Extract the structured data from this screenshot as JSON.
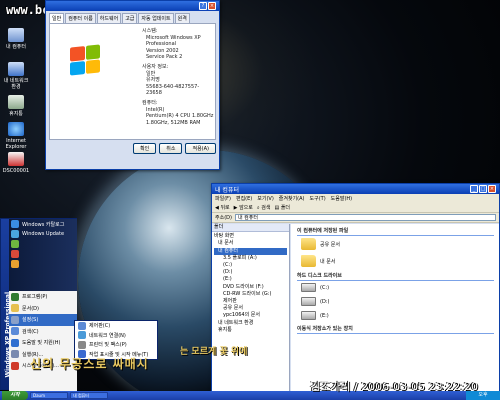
{
  "watermark": "www.bcpark.net",
  "desktop_icons": [
    {
      "label": "내 컴퓨터"
    },
    {
      "label": "내 네트워크 환경"
    },
    {
      "label": "휴지통"
    },
    {
      "label": "Internet Explorer"
    },
    {
      "label": "DSC00001"
    }
  ],
  "sysprops": {
    "tabs": [
      "일반",
      "컴퓨터 이름",
      "하드웨어",
      "고급",
      "자동 업데이트",
      "원격"
    ],
    "system_heading": "시스템:",
    "system_lines": [
      "Microsoft Windows XP",
      "Professional",
      "Version 2002",
      "Service Pack 2"
    ],
    "user_heading": "사용자 정보:",
    "user_lines": [
      "일반",
      "유저명",
      "55683-640-4827557-23658"
    ],
    "computer_heading": "컴퓨터:",
    "computer_lines": [
      "Intel(R)",
      "Pentium(R) 4 CPU 1.80GHz",
      "1.80GHz, 512MB RAM"
    ],
    "buttons": [
      "확인",
      "취소",
      "적용(A)"
    ]
  },
  "explorer": {
    "title": "내 컴퓨터",
    "menu": [
      "파일(F)",
      "편집(E)",
      "보기(V)",
      "즐겨찾기(A)",
      "도구(T)",
      "도움말(H)"
    ],
    "toolbar": [
      "뒤로",
      "앞으로",
      "검색",
      "폴더"
    ],
    "address_label": "주소(D)",
    "address": "내 컴퓨터",
    "tree_header": "폴더",
    "tree": [
      {
        "label": "바탕 화면",
        "selected": false
      },
      {
        "label": "내 문서",
        "selected": false
      },
      {
        "label": "내 컴퓨터",
        "selected": true
      },
      {
        "label": "3.5 플로피 (A:)",
        "selected": false
      },
      {
        "label": "(C:)",
        "selected": false
      },
      {
        "label": "(D:)",
        "selected": false
      },
      {
        "label": "(E:)",
        "selected": false
      },
      {
        "label": "DVD 드라이브 (F:)",
        "selected": false
      },
      {
        "label": "CD-RW 드라이브 (G:)",
        "selected": false
      },
      {
        "label": "제어판",
        "selected": false
      },
      {
        "label": "공유 문서",
        "selected": false
      },
      {
        "label": "ypc1064의 문서",
        "selected": false
      },
      {
        "label": "내 네트워크 환경",
        "selected": false
      },
      {
        "label": "휴지통",
        "selected": false
      }
    ],
    "group1": "이 컴퓨터에 저장된 파일",
    "folders": [
      "공유 문서",
      "내 문서"
    ],
    "group2": "하드 디스크 드라이브",
    "drives": [
      "(C:)",
      "(D:)",
      "(E:)"
    ],
    "group3": "이동식 저장소가 있는 장치"
  },
  "startmenu": {
    "vertical_text": "Windows XP Professional",
    "top_items": [
      "Windows 카탈로그",
      "Windows Update",
      "",
      "",
      ""
    ],
    "bottom_items": [
      "프로그램(P)",
      "문서(D)",
      "설정(S)",
      "검색(C)",
      "도움말 및 지원(H)",
      "실행(R)...",
      "시스템 종료(U)..."
    ],
    "highlighted": 2
  },
  "submenu": {
    "items": [
      "제어판(C)",
      "네트워크 연결(N)",
      "프린터 및 팩스(P)",
      "작업 표시줄 및 시작 메뉴(T)"
    ]
  },
  "taskbar": {
    "start_label": "시작",
    "tasks": [
      "Daum",
      "내 컴퓨터"
    ],
    "clock": "오후"
  },
  "overlay": {
    "korean_line1": "신의 무공스로 싸매시",
    "korean_line2": "는 모르게 꽃 위에",
    "stamp": "김조가리 / 2006-03-05 23:22:20"
  },
  "colors": {
    "xp_blue": "#0a3fb4",
    "xp_green": "#3f9d3a",
    "select": "#316ac5"
  }
}
